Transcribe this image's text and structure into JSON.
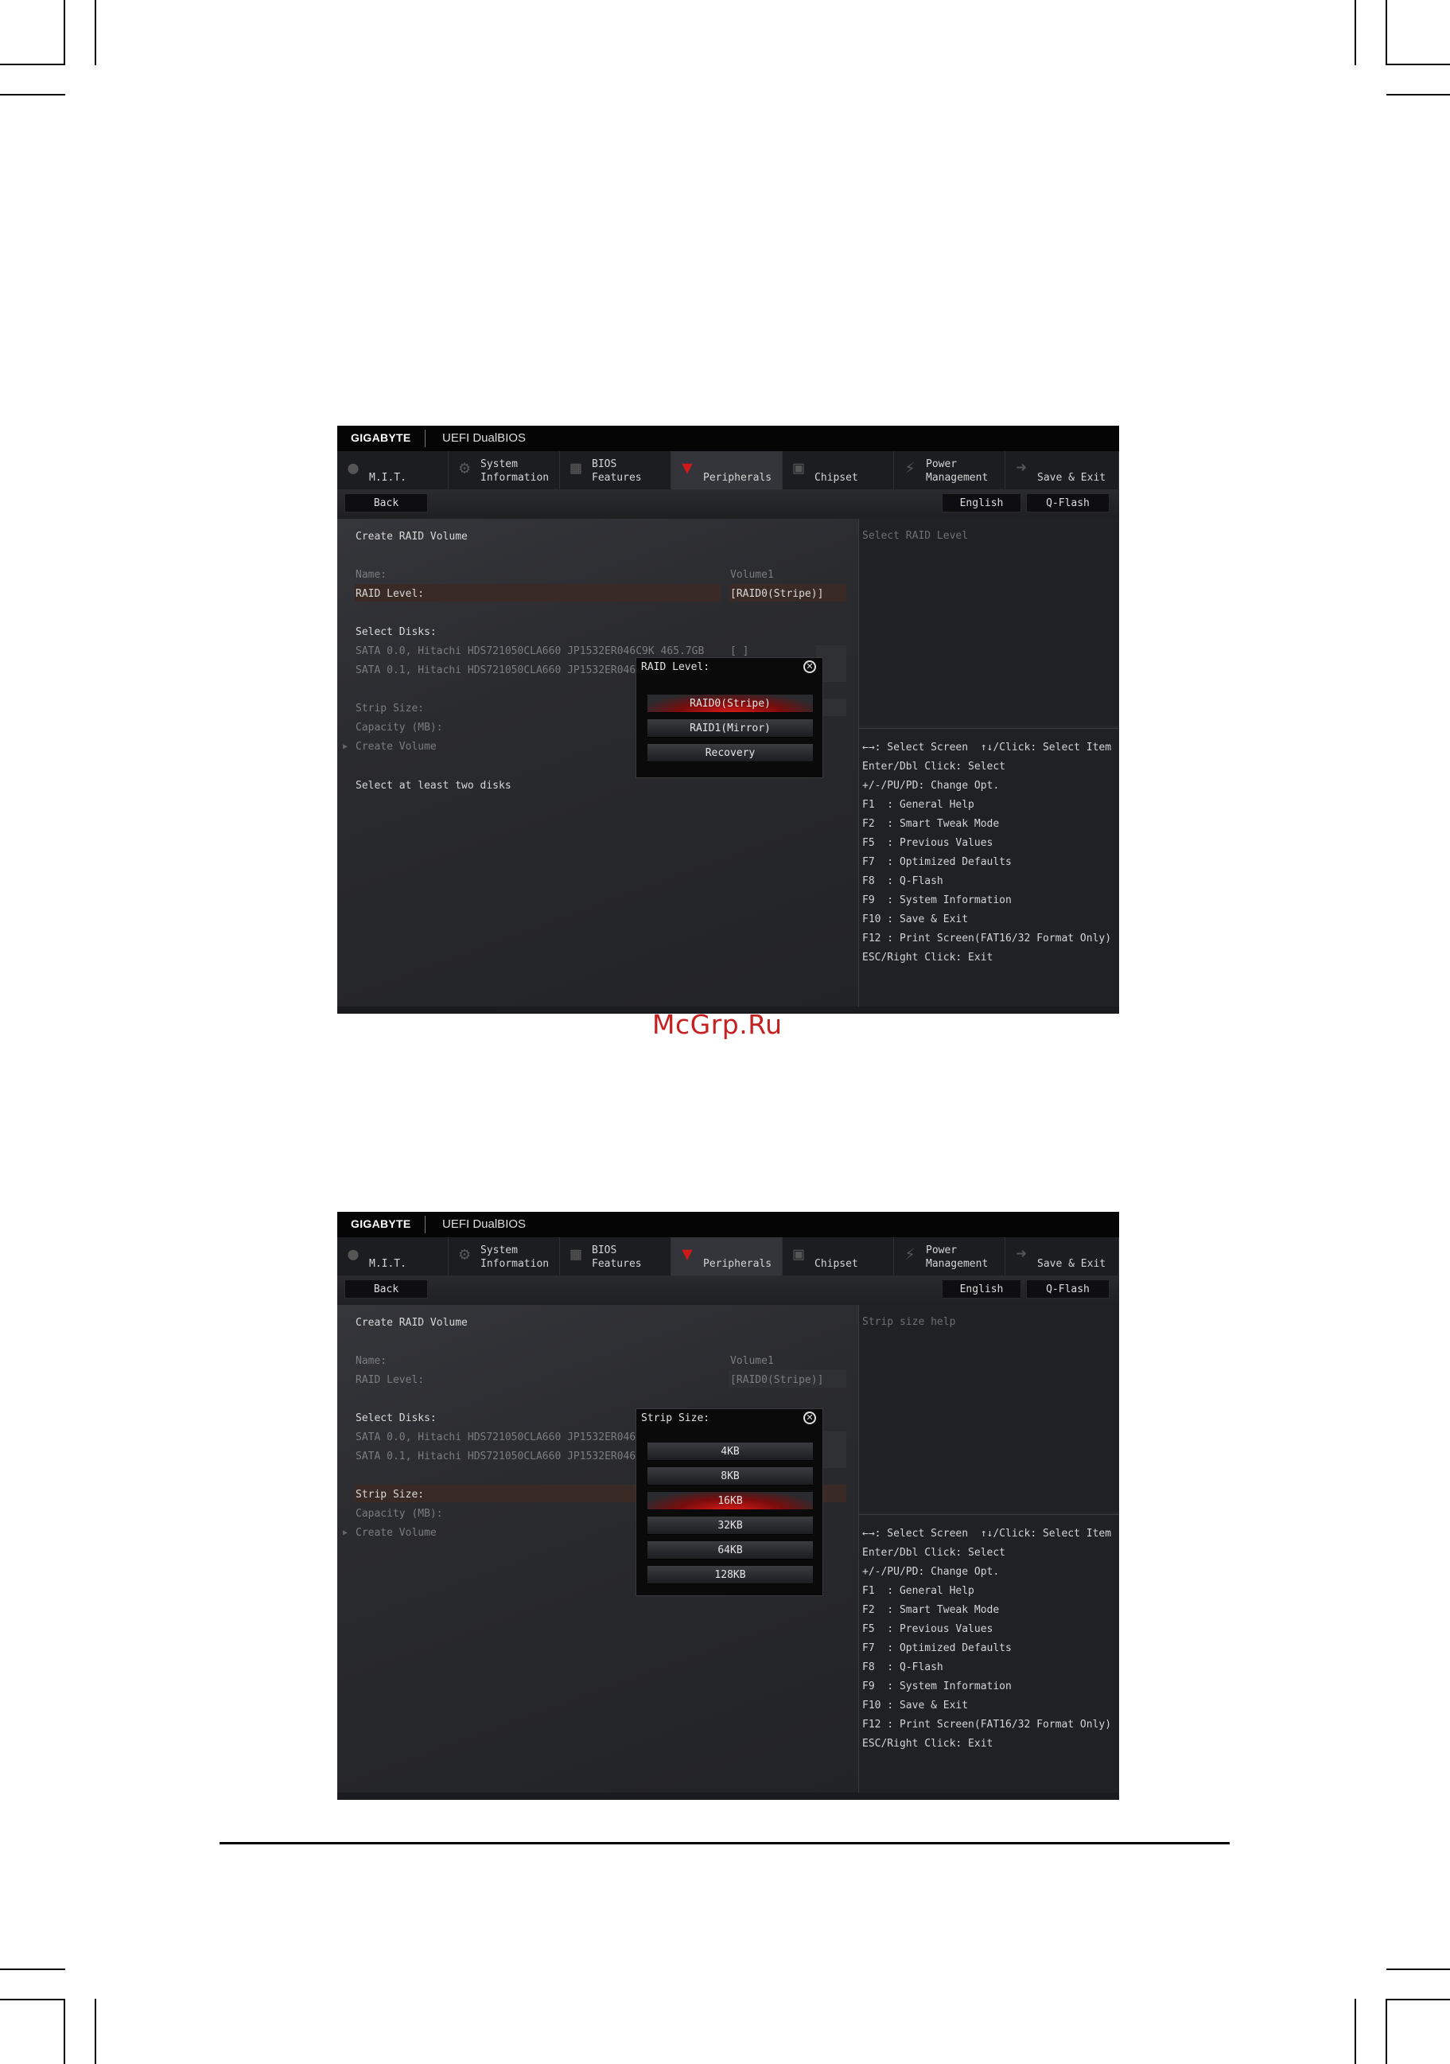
{
  "watermark": "McGrp.Ru",
  "screens": [
    {
      "brand": "GIGABYTE",
      "product": "UEFI DualBIOS",
      "tabs": [
        {
          "label": "M.I.T.",
          "icon": "mit-icon"
        },
        {
          "label": "System\nInformation",
          "icon": "gear-icon"
        },
        {
          "label": "BIOS\nFeatures",
          "icon": "bios-features-icon"
        },
        {
          "label": "Peripherals",
          "icon": "peripherals-icon",
          "active": true
        },
        {
          "label": "Chipset",
          "icon": "chipset-icon"
        },
        {
          "label": "Power\nManagement",
          "icon": "power-icon"
        },
        {
          "label": "Save & Exit",
          "icon": "exit-icon"
        }
      ],
      "toolbar": {
        "back": "Back",
        "language": "English",
        "qflash": "Q-Flash"
      },
      "form": {
        "title": "Create RAID Volume",
        "name_label": "Name:",
        "name_value": "Volume1",
        "raid_label": "RAID Level:",
        "raid_value": "[RAID0(Stripe)]",
        "disks_label": "Select Disks:",
        "disk0": "SATA 0.0, Hitachi HDS721050CLA660 JP1532ER046C9K 465.7GB",
        "disk1": "SATA 0.1, Hitachi HDS721050CLA660 JP1532ER046EJ",
        "disk0_value": "[ ]",
        "strip_label": "Strip Size:",
        "capacity_label": "Capacity (MB):",
        "create": "Create Volume",
        "notice": "Select at least two disks"
      },
      "help": "Select RAID Level",
      "popup": {
        "title": "RAID Level:",
        "options": [
          "RAID0(Stripe)",
          "RAID1(Mirror)",
          "Recovery"
        ],
        "selected_index": 0
      }
    },
    {
      "brand": "GIGABYTE",
      "product": "UEFI DualBIOS",
      "tabs": [
        {
          "label": "M.I.T.",
          "icon": "mit-icon"
        },
        {
          "label": "System\nInformation",
          "icon": "gear-icon"
        },
        {
          "label": "BIOS\nFeatures",
          "icon": "bios-features-icon"
        },
        {
          "label": "Peripherals",
          "icon": "peripherals-icon",
          "active": true
        },
        {
          "label": "Chipset",
          "icon": "chipset-icon"
        },
        {
          "label": "Power\nManagement",
          "icon": "power-icon"
        },
        {
          "label": "Save & Exit",
          "icon": "exit-icon"
        }
      ],
      "toolbar": {
        "back": "Back",
        "language": "English",
        "qflash": "Q-Flash"
      },
      "form": {
        "title": "Create RAID Volume",
        "name_label": "Name:",
        "name_value": "Volume1",
        "raid_label": "RAID Level:",
        "raid_value": "[RAID0(Stripe)]",
        "disks_label": "Select Disks:",
        "disk0": "SATA 0.0, Hitachi HDS721050CLA660 JP1532ER046",
        "disk1": "SATA 0.1, Hitachi HDS721050CLA660 JP1532ER046EJ",
        "strip_label": "Strip Size:",
        "capacity_label": "Capacity (MB):",
        "create": "Create Volume"
      },
      "help": "Strip size help",
      "popup": {
        "title": "Strip Size:",
        "options": [
          "4KB",
          "8KB",
          "16KB",
          "32KB",
          "64KB",
          "128KB"
        ],
        "selected_index": 2
      }
    }
  ],
  "keys": [
    "←→: Select Screen  ↑↓/Click: Select Item",
    "Enter/Dbl Click: Select",
    "+/-/PU/PD: Change Opt.",
    "F1  : General Help",
    "F2  : Smart Tweak Mode",
    "F5  : Previous Values",
    "F7  : Optimized Defaults",
    "F8  : Q-Flash",
    "F9  : System Information",
    "F10 : Save & Exit",
    "F12 : Print Screen(FAT16/32 Format Only)",
    "ESC/Right Click: Exit"
  ]
}
